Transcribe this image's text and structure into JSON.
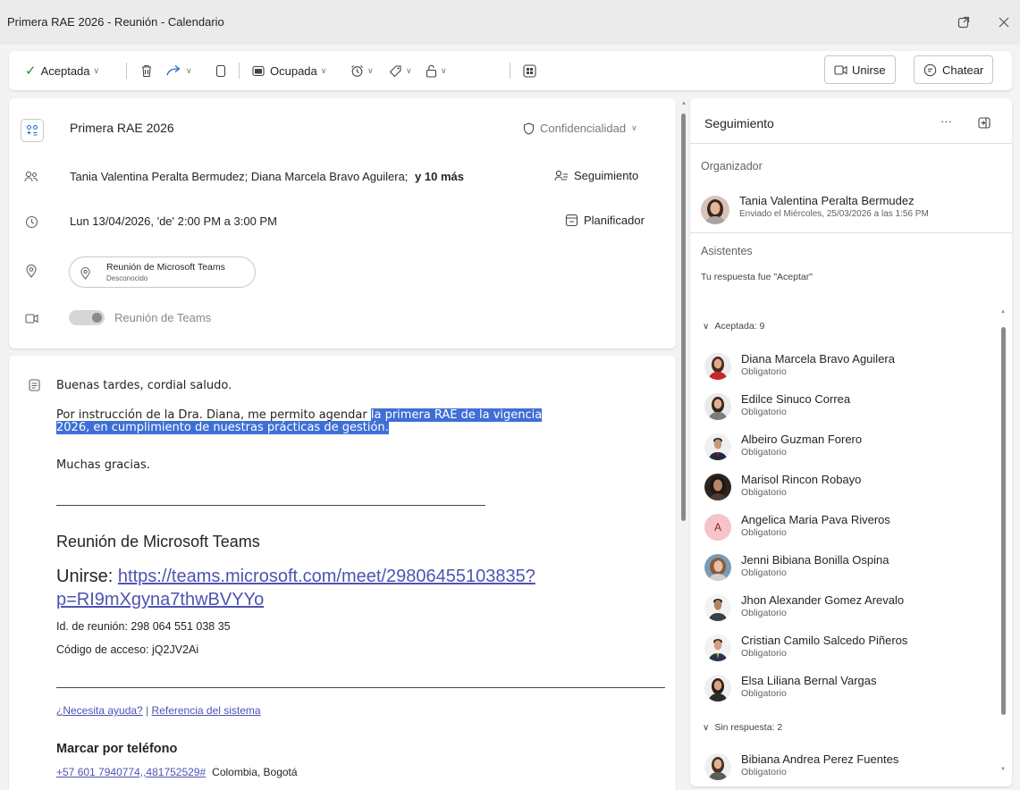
{
  "window": {
    "title": "Primera RAE 2026 - Reunión - Calendario"
  },
  "toolbar": {
    "accepted_label": "Aceptada",
    "busy_label": "Ocupada",
    "join_label": "Unirse",
    "chat_label": "Chatear"
  },
  "details": {
    "subject": "Primera RAE 2026",
    "sensitivity_label": "Confidencialidad",
    "attendees_prefix": "Tania Valentina Peralta Bermudez;  Diana Marcela Bravo Aguilera;",
    "attendees_more": "y 10 más",
    "tracking_label": "Seguimiento",
    "datetime": "Lun 13/04/2026, 'de' 2:00 PM a 3:00 PM",
    "scheduler_label": "Planificador",
    "location_name": "Reunión de Microsoft Teams",
    "location_status": "Desconocido",
    "teams_toggle_label": "Reunión de Teams"
  },
  "message": {
    "greeting": "Buenas tardes, cordial saludo.",
    "line1_plain": "Por instrucción de la Dra. Diana, me permito agendar ",
    "line1_highlight": "la primera RAE de la vigencia ",
    "line2_highlight": "2026, en cumplimiento de nuestras prácticas de gestión.",
    "thanks": "Muchas gracias.",
    "separator": "________________________________________________________________________________",
    "teams_heading": "Reunión de Microsoft Teams",
    "join_prefix": "Unirse: ",
    "join_url_line1": "https://teams.microsoft.com/meet/29806455103835?",
    "join_url_line2": "p=RI9mXgyna7thwBVYYo",
    "meeting_id": "Id. de reunión: 298 064 551 038 35",
    "access_code": "Código de acceso: jQ2JV2Ai",
    "help_link": "¿Necesita ayuda?",
    "link_separator": " | ",
    "system_ref_link": "Referencia del sistema",
    "dial_heading": "Marcar por teléfono",
    "phone_link": "+57 601 7940774,,481752529#",
    "phone_location": "Colombia, Bogotá"
  },
  "tracking_panel": {
    "title": "Seguimiento",
    "more_label": "···",
    "organizer_heading": "Organizador",
    "organizer_name": "Tania Valentina Peralta Bermudez",
    "organizer_sent": "Enviado el Miércoles, 25/03/2026 a las 1:56 PM",
    "attendees_heading": "Asistentes",
    "response_note": "Tu respuesta fue \"Aceptar\"",
    "accepted_group": "Aceptada: 9",
    "no_response_group": "Sin respuesta: 2",
    "attendees": [
      {
        "name": "Diana Marcela Bravo Aguilera",
        "role": "Obligatorio"
      },
      {
        "name": "Edilce Sinuco Correa",
        "role": "Obligatorio"
      },
      {
        "name": "Albeiro Guzman Forero",
        "role": "Obligatorio"
      },
      {
        "name": "Marisol Rincon Robayo",
        "role": "Obligatorio"
      },
      {
        "name": "Angelica Maria Pava Riveros",
        "role": "Obligatorio",
        "initial": "A"
      },
      {
        "name": "Jenni Bibiana Bonilla Ospina",
        "role": "Obligatorio"
      },
      {
        "name": "Jhon Alexander Gomez Arevalo",
        "role": "Obligatorio"
      },
      {
        "name": "Cristian Camilo Salcedo Piñeros",
        "role": "Obligatorio"
      },
      {
        "name": "Elsa Liliana Bernal Vargas",
        "role": "Obligatorio"
      }
    ],
    "no_response": [
      {
        "name": "Bibiana Andrea Perez Fuentes",
        "role": "Obligatorio"
      }
    ]
  }
}
